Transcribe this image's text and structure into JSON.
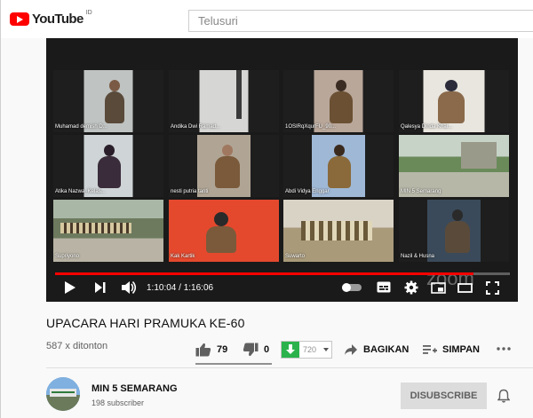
{
  "header": {
    "logo_text": "YouTube",
    "logo_region": "ID",
    "search_placeholder": "Telusuri"
  },
  "player": {
    "time_current": "1:10:04",
    "time_total": "1:16:06",
    "progress": 0.92,
    "zoom_watermark": "zoom",
    "participants": [
      "Muhamad demish D...",
      "Andika Dwi Ramad...",
      "1OSIRqXqurFU_90...",
      "Qalesya Dinda Khai...",
      "Atika Nazwa_Kelas...",
      "nesti putria tanti",
      "Abdi Vidya Enggar",
      "MIN 5 Semarang",
      "Supriyono",
      "Kak Kartik",
      "Suwarto",
      "Nazil & Husna"
    ]
  },
  "video": {
    "title": "UPACARA HARI PRAMUKA KE-60",
    "views": "587 x ditonton",
    "likes": "79",
    "dislikes": "0",
    "download_count": "720",
    "share_label": "BAGIKAN",
    "save_label": "SIMPAN"
  },
  "channel": {
    "name": "MIN 5 SEMARANG",
    "subscribers": "198 subscriber",
    "subscribe_label": "DISUBSCRIBE"
  },
  "colors": {
    "brand_red": "#ff0000",
    "download_green": "#2bb24c",
    "active_speaker": "#3fbf3f"
  }
}
